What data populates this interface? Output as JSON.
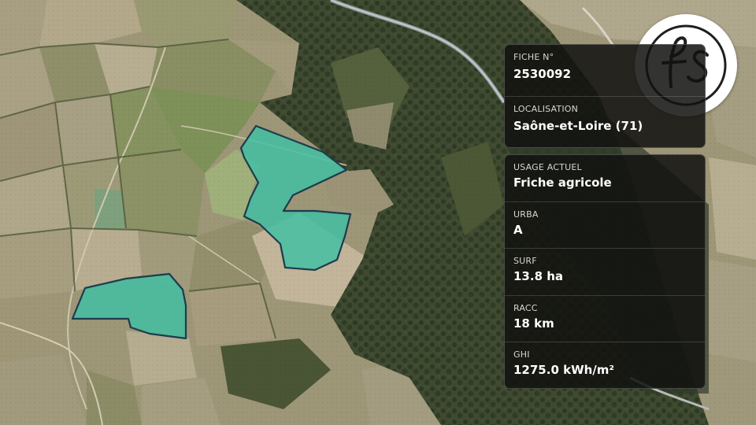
{
  "map": {
    "parcel_color": "#3fbfa3",
    "parcel_border": "#1f3b4d"
  },
  "card": {
    "fiche_label": "FICHE N°",
    "fiche_value": "2530092",
    "localisation_label": "LOCALISATION",
    "localisation_value": "Saône-et-Loire (71)"
  },
  "details": {
    "usage_label": "USAGE ACTUEL",
    "usage_value": "Friche agricole",
    "urba_label": "URBA",
    "urba_value": "A",
    "surf_label": "SURF",
    "surf_value": "13.8 ha",
    "racc_label": "RACC",
    "racc_value": "18 km",
    "ghi_label": "GHI",
    "ghi_value": "1275.0 kWh/m²"
  },
  "logo": {
    "icon": "fs-monogram-logo",
    "text": "fs"
  }
}
